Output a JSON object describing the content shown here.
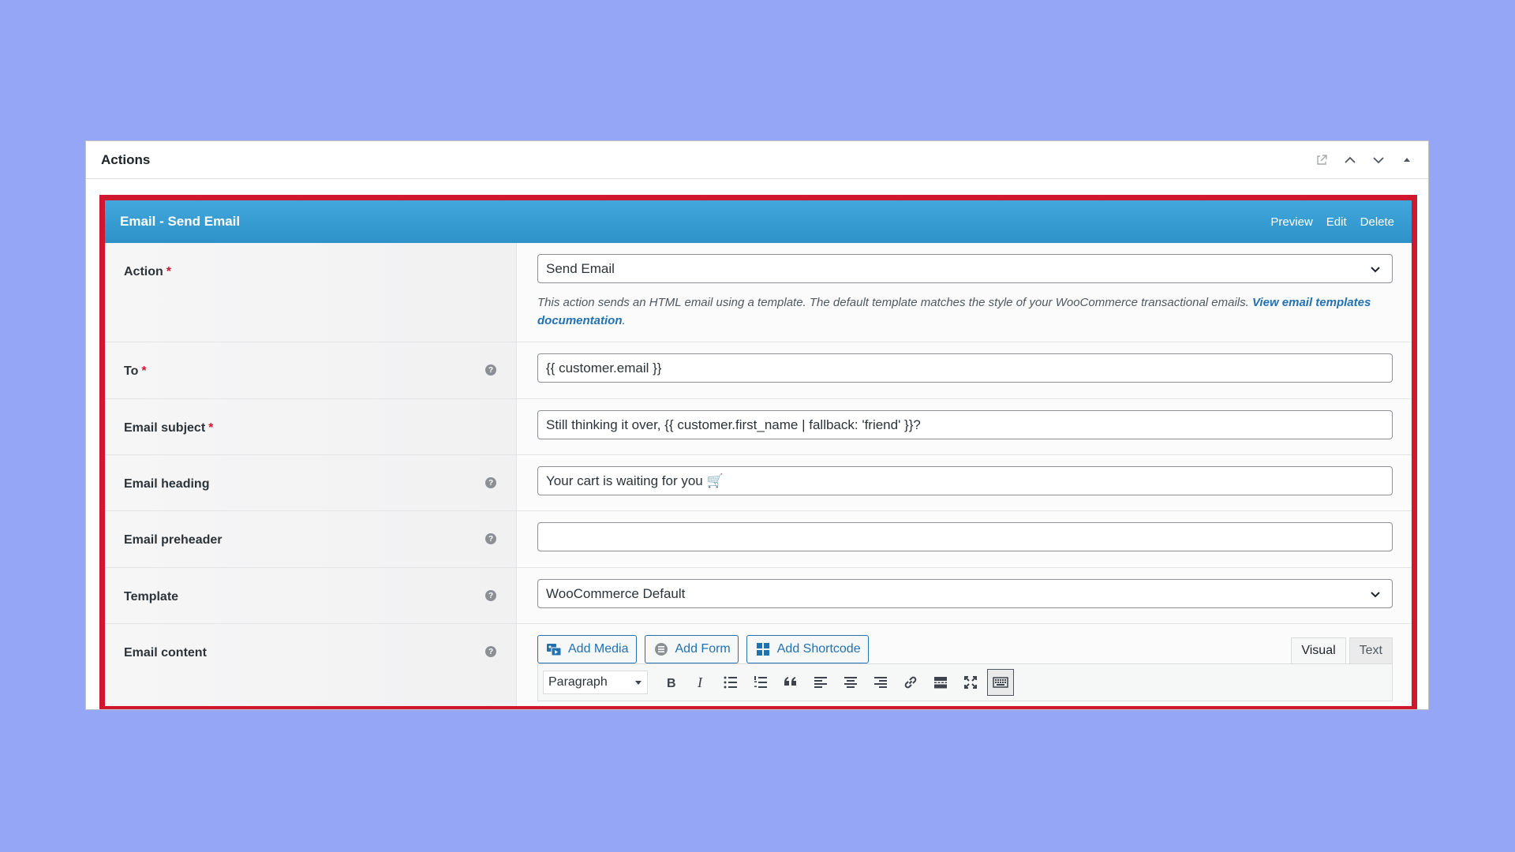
{
  "panel": {
    "title": "Actions",
    "controls": [
      "external-link-icon",
      "chevron-up-icon",
      "chevron-down-icon",
      "collapse-triangle-icon"
    ]
  },
  "action": {
    "header_title": "Email - Send Email",
    "links": {
      "preview": "Preview",
      "edit": "Edit",
      "delete": "Delete"
    },
    "accent_color": "#2e97cd",
    "highlight_color": "#d0172e"
  },
  "fields": {
    "action": {
      "label": "Action",
      "required": "*",
      "value": "Send Email",
      "description": "This action sends an HTML email using a template. The default template matches the style of your WooCommerce transactional emails.",
      "description_link": "View email templates documentation"
    },
    "to": {
      "label": "To",
      "required": "*",
      "value": "{{ customer.email }}"
    },
    "subject": {
      "label": "Email subject",
      "required": "*",
      "value": "Still thinking it over, {{ customer.first_name | fallback: 'friend' }}?"
    },
    "heading": {
      "label": "Email heading",
      "value": "Your cart is waiting for you 🛒"
    },
    "preheader": {
      "label": "Email preheader",
      "value": ""
    },
    "template": {
      "label": "Template",
      "value": "WooCommerce Default"
    },
    "content": {
      "label": "Email content",
      "buttons": {
        "add_media": "Add Media",
        "add_form": "Add Form",
        "add_shortcode": "Add Shortcode"
      },
      "tabs": {
        "visual": "Visual",
        "text": "Text"
      },
      "format_select": "Paragraph"
    }
  }
}
